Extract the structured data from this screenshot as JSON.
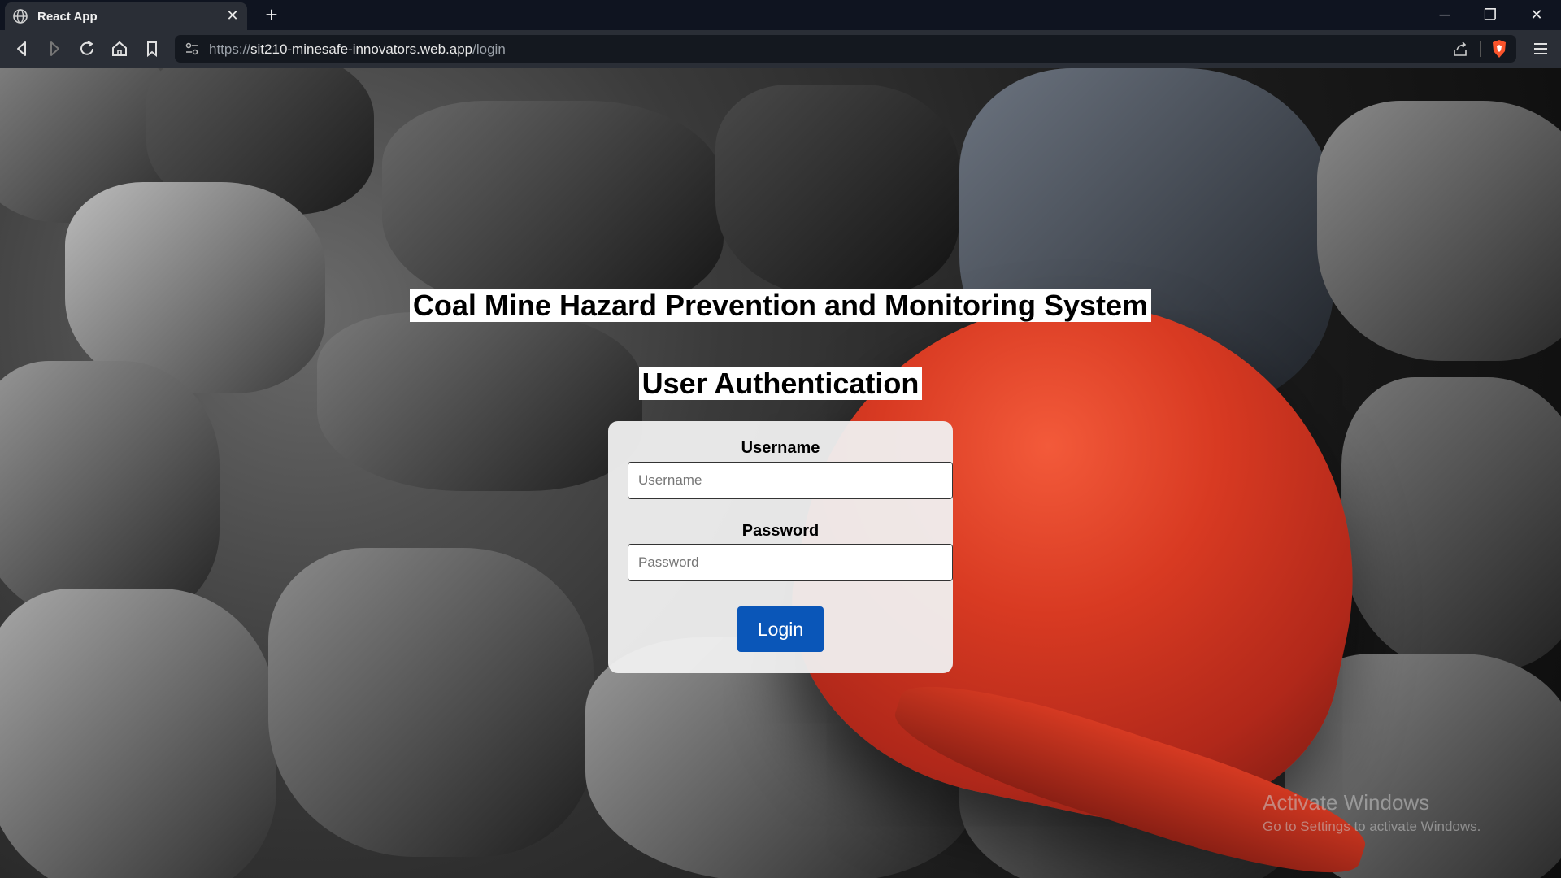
{
  "browser": {
    "tab_title": "React App",
    "url_scheme": "https://",
    "url_host": "sit210-minesafe-innovators.web.app",
    "url_path": "/login",
    "icons": {
      "favicon": "globe-icon",
      "close": "close-icon",
      "new_tab": "plus-icon",
      "back": "back-icon",
      "forward": "forward-icon",
      "reload": "reload-icon",
      "home": "home-icon",
      "bookmark": "bookmark-icon",
      "site_info": "site-info-icon",
      "share": "share-icon",
      "shields": "brave-shield-icon",
      "menu": "hamburger-menu-icon"
    }
  },
  "page": {
    "title": "Coal Mine Hazard Prevention and Monitoring System",
    "subtitle": "User Authentication",
    "form": {
      "username_label": "Username",
      "username_placeholder": "Username",
      "username_value": "",
      "password_label": "Password",
      "password_placeholder": "Password",
      "password_value": "",
      "login_label": "Login"
    }
  },
  "os_watermark": {
    "line1": "Activate Windows",
    "line2": "Go to Settings to activate Windows."
  },
  "colors": {
    "login_button": "#0a56b8",
    "card_bg": "#f0f0f0",
    "helmet": "#d83a22",
    "tabbar": "#0f1420",
    "navbar": "#2a2e36"
  }
}
